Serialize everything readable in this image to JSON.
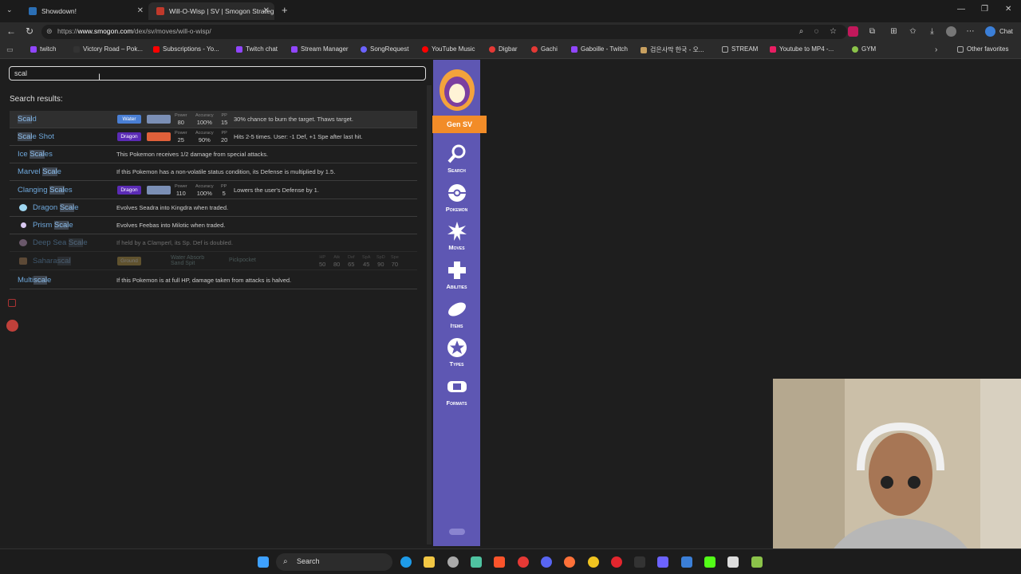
{
  "tabs": [
    {
      "title": "Showdown!",
      "active": false
    },
    {
      "title": "Will-O-Wisp | SV | Smogon Strateg",
      "active": true
    }
  ],
  "address": {
    "prefix": "https://",
    "domain": "www.smogon.com",
    "path": "/dex/sv/moves/will-o-wisp/"
  },
  "chat_label": "Chat",
  "bookmarks": [
    {
      "label": "twitch",
      "color": "#9146ff"
    },
    {
      "label": "Victory Road – Pok...",
      "color": "#333"
    },
    {
      "label": "Subscriptions - Yo...",
      "color": "#ff0000"
    },
    {
      "label": "Twitch chat",
      "color": "#9146ff"
    },
    {
      "label": "Stream Manager",
      "color": "#9146ff"
    },
    {
      "label": "SongRequest",
      "color": "#6c63ff"
    },
    {
      "label": "YouTube Music",
      "color": "#ff0000"
    },
    {
      "label": "Digbar",
      "color": "#e53935"
    },
    {
      "label": "Gachi",
      "color": "#e53935"
    },
    {
      "label": "Gaboille - Twitch",
      "color": "#9146ff"
    },
    {
      "label": "검은사막 한국 - 오...",
      "color": "#c8a060"
    },
    {
      "label": "STREAM",
      "color": "#888"
    },
    {
      "label": "Youtube to MP4 -...",
      "color": "#e91e63"
    },
    {
      "label": "GYM",
      "color": "#8bc34a"
    }
  ],
  "other_favorites": "Other favorites",
  "search": {
    "value": "scal",
    "results_label": "Search results:"
  },
  "results": [
    {
      "pre": "",
      "hl": "Scal",
      "post": "d",
      "type": "Water",
      "type_color": "#4a7fd4",
      "cat_color": "#7b8fb5",
      "power": "80",
      "accuracy": "100%",
      "pp": "15",
      "desc": "30% chance to burn the target. Thaws target."
    },
    {
      "pre": "",
      "hl": "Scal",
      "post": "e Shot",
      "type": "Dragon",
      "type_color": "#5b2bb5",
      "cat_color": "#e0603a",
      "power": "25",
      "accuracy": "90%",
      "pp": "20",
      "desc": "Hits 2-5 times. User: -1 Def, +1 Spe after last hit."
    },
    {
      "pre": "Ice ",
      "hl": "Scal",
      "post": "es",
      "desc": "This Pokemon receives 1/2 damage from special attacks."
    },
    {
      "pre": "Marvel ",
      "hl": "Scal",
      "post": "e",
      "desc": "If this Pokemon has a non-volatile status condition, its Defense is multiplied by 1.5."
    },
    {
      "pre": "Clanging ",
      "hl": "Scal",
      "post": "es",
      "type": "Dragon",
      "type_color": "#5b2bb5",
      "cat_color": "#7b8fb5",
      "power": "110",
      "accuracy": "100%",
      "pp": "5",
      "desc": "Lowers the user's Defense by 1."
    },
    {
      "pre": "Dragon ",
      "hl": "Scal",
      "post": "e",
      "desc": "Evolves Seadra into Kingdra when traded."
    },
    {
      "pre": "Prism ",
      "hl": "Scal",
      "post": "e",
      "desc": "Evolves Feebas into Milotic when traded."
    },
    {
      "pre": "Deep Sea ",
      "hl": "Scal",
      "post": "e",
      "desc": "If held by a Clamperl, its Sp. Def is doubled."
    },
    {
      "pre": "Sandaconda",
      "hl": "",
      "post": "",
      "display": "Sahara",
      "hl2": "scal",
      "type": "Ground",
      "abilities": [
        "Water Absorb",
        "Sand Spit"
      ],
      "hidden": "Pickpocket",
      "stats": {
        "HP": "50",
        "Atk": "80",
        "Def": "65",
        "SpA": "45",
        "SpD": "90",
        "Spe": "70"
      }
    },
    {
      "pre": "Multi",
      "hl": "scal",
      "post": "e",
      "desc": "If this Pokemon is at full HP, damage taken from attacks is halved."
    }
  ],
  "stat_labels": {
    "power": "Power",
    "accuracy": "Accuracy",
    "pp": "PP"
  },
  "gen_label": "Gen SV",
  "nav": [
    "Search",
    "Pokemon",
    "Moves",
    "Abilities",
    "Items",
    "Types",
    "Formats"
  ],
  "taskbar_search": "Search"
}
